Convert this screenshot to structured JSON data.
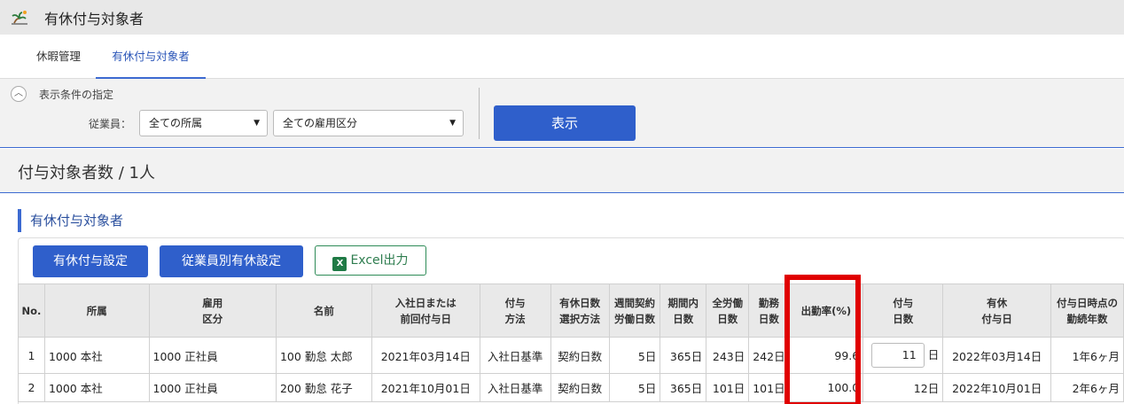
{
  "window": {
    "title": "有休付与対象者",
    "icon": "palm-tree-icon"
  },
  "tabs": [
    {
      "label": "休暇管理"
    },
    {
      "label": "有休付与対象者"
    }
  ],
  "filter": {
    "toggle_icon": "chevron-up-icon",
    "section_label": "表示条件の指定",
    "employee_label": "従業員：",
    "department_select": "全ての所属",
    "employment_select": "全ての雇用区分",
    "show_button": "表示"
  },
  "summary": {
    "count_text": "付与対象者数 / 1人"
  },
  "section": {
    "title": "有休付与対象者"
  },
  "actions": {
    "grant_settings": "有休付与設定",
    "employee_settings": "従業員別有休設定",
    "excel_export": "Excel出力"
  },
  "table": {
    "headers": {
      "no": "No.",
      "dept": "所属",
      "emp_type_1": "雇用",
      "emp_type_2": "区分",
      "name": "名前",
      "join_1": "入社日または",
      "join_2": "前回付与日",
      "method_1": "付与",
      "method_2": "方法",
      "days_sel_1": "有休日数",
      "days_sel_2": "選択方法",
      "weekly_1": "週間契約",
      "weekly_2": "労働日数",
      "period_1": "期間内",
      "period_2": "日数",
      "total_1": "全労働",
      "total_2": "日数",
      "work_1": "勤務",
      "work_2": "日数",
      "attendance": "出勤率(%)",
      "grant_days_1": "付与",
      "grant_days_2": "日数",
      "grant_date_1": "有休",
      "grant_date_2": "付与日",
      "tenure_1": "付与日時点の",
      "tenure_2": "勤続年数"
    },
    "rows": [
      {
        "no": "1",
        "dept": "1000 本社",
        "emp_type": "1000 正社員",
        "name": "100 勤怠 太郎",
        "join": "2021年03月14日",
        "method": "入社日基準",
        "days_sel": "契約日数",
        "weekly": "5日",
        "period": "365日",
        "total": "243日",
        "work": "242日",
        "attendance": "99.6",
        "grant_days": "11",
        "grant_unit": "日",
        "grant_date": "2022年03月14日",
        "tenure": "1年6ヶ月"
      },
      {
        "no": "2",
        "dept": "1000 本社",
        "emp_type": "1000 正社員",
        "name": "200 勤怠 花子",
        "join": "2021年10月01日",
        "method": "入社日基準",
        "days_sel": "契約日数",
        "weekly": "5日",
        "period": "365日",
        "total": "101日",
        "work": "101日",
        "attendance": "100.0",
        "grant_days": "12日",
        "grant_date": "2022年10月01日",
        "tenure": "2年6ヶ月"
      }
    ]
  },
  "colors": {
    "accent": "#2f5fcb",
    "highlight": "#e00000",
    "excel_green": "#1f7a45"
  }
}
